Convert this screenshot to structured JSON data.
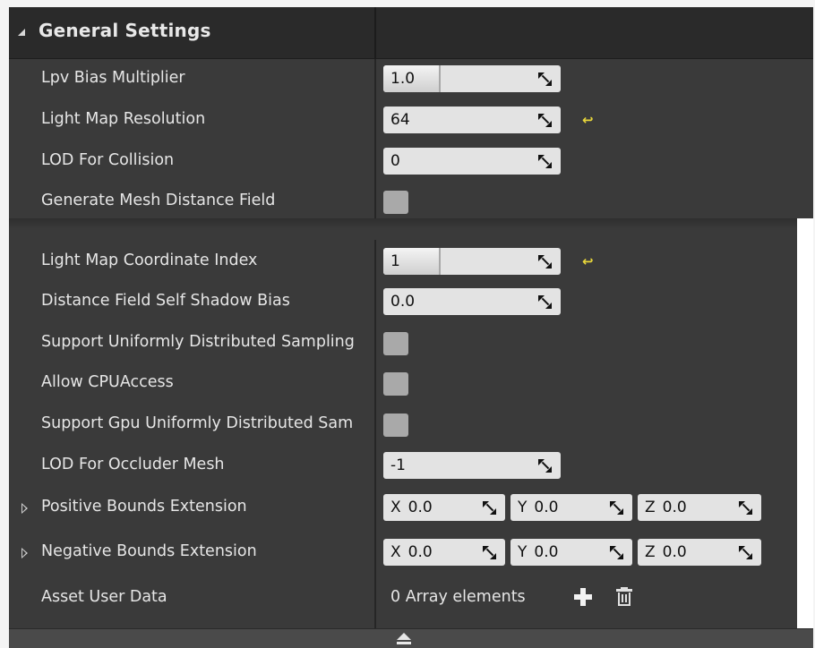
{
  "section": {
    "title": "General Settings"
  },
  "rows": {
    "lpv_bias": {
      "label": "Lpv Bias Multiplier",
      "value": "1.0"
    },
    "light_map_res": {
      "label": "Light Map Resolution",
      "value": "64"
    },
    "lod_collision": {
      "label": "LOD For Collision",
      "value": "0"
    },
    "gen_mesh_df": {
      "label": "Generate Mesh Distance Field",
      "checked": false
    },
    "light_map_coord": {
      "label": "Light Map Coordinate Index",
      "value": "1"
    },
    "df_self_shadow": {
      "label": "Distance Field Self Shadow Bias",
      "value": "0.0"
    },
    "support_uniform": {
      "label": "Support Uniformly Distributed Sampling",
      "checked": false
    },
    "allow_cpu": {
      "label": "Allow CPUAccess",
      "checked": false
    },
    "support_gpu_uniform": {
      "label": "Support Gpu Uniformly Distributed Sam",
      "checked": false
    },
    "lod_occluder": {
      "label": "LOD For Occluder Mesh",
      "value": "-1"
    },
    "pos_bounds": {
      "label": "Positive Bounds Extension",
      "x": "0.0",
      "y": "0.0",
      "z": "0.0"
    },
    "neg_bounds": {
      "label": "Negative Bounds Extension",
      "x": "0.0",
      "y": "0.0",
      "z": "0.0"
    },
    "asset_user_data": {
      "label": "Asset User Data",
      "value": "0 Array elements"
    }
  },
  "axes": {
    "x": "X",
    "y": "Y",
    "z": "Z"
  },
  "icons": {
    "reset": "reset-to-default-icon",
    "drag": "drag-spinner-icon",
    "add": "plus-icon",
    "delete": "trash-icon",
    "collapse": "collapse-up-icon"
  },
  "colors": {
    "panel": "#3a3a3a",
    "header": "#2a2a2a",
    "field": "#e3e3e3",
    "reset_accent": "#e8d63a"
  }
}
